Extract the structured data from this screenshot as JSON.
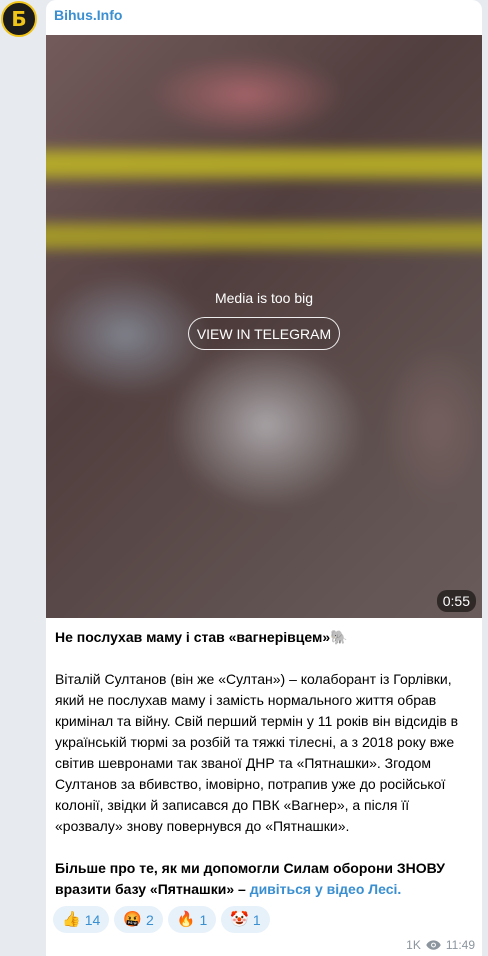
{
  "channel": {
    "name": "Bihus.Info",
    "avatar_letter": "Б"
  },
  "media": {
    "notice": "Media is too big",
    "button_label": "VIEW IN TELEGRAM",
    "duration": "0:55"
  },
  "post": {
    "headline": "Не послухав маму і став «вагнерівцем»🐘",
    "body": "Віталій Султанов (він же «Султан») – колаборант із Горлівки, який не послухав маму і замість нормального життя обрав кримінал та війну. Свій перший термін у 11 років він відсидів в українській тюрмі за розбій та тяжкі тілесні, а з 2018 року вже світив шевронами так званої ДНР та «Пятнашки». Згодом Султанов за вбивство, імовірно, потрапив уже до російської колонії, звідки й записався до ПВК «Вагнер», а після її «розвалу» знову повернувся до «Пятнашки».",
    "cta": "Більше про те, як ми допомогли Силам оборони ЗНОВУ вразити базу «Пятнашки» – ",
    "link_text": "дивіться у відео Лесі."
  },
  "reactions": [
    {
      "emoji": "👍",
      "count": "14"
    },
    {
      "emoji": "🤬",
      "count": "2"
    },
    {
      "emoji": "🔥",
      "count": "1"
    },
    {
      "emoji": "🤡",
      "count": "1"
    }
  ],
  "footer": {
    "views": "1K",
    "time": "11:49"
  },
  "colors": {
    "accent": "#3a8fd1",
    "page_bg": "#e7ebf0",
    "reaction_bg": "#e7f1fa"
  }
}
